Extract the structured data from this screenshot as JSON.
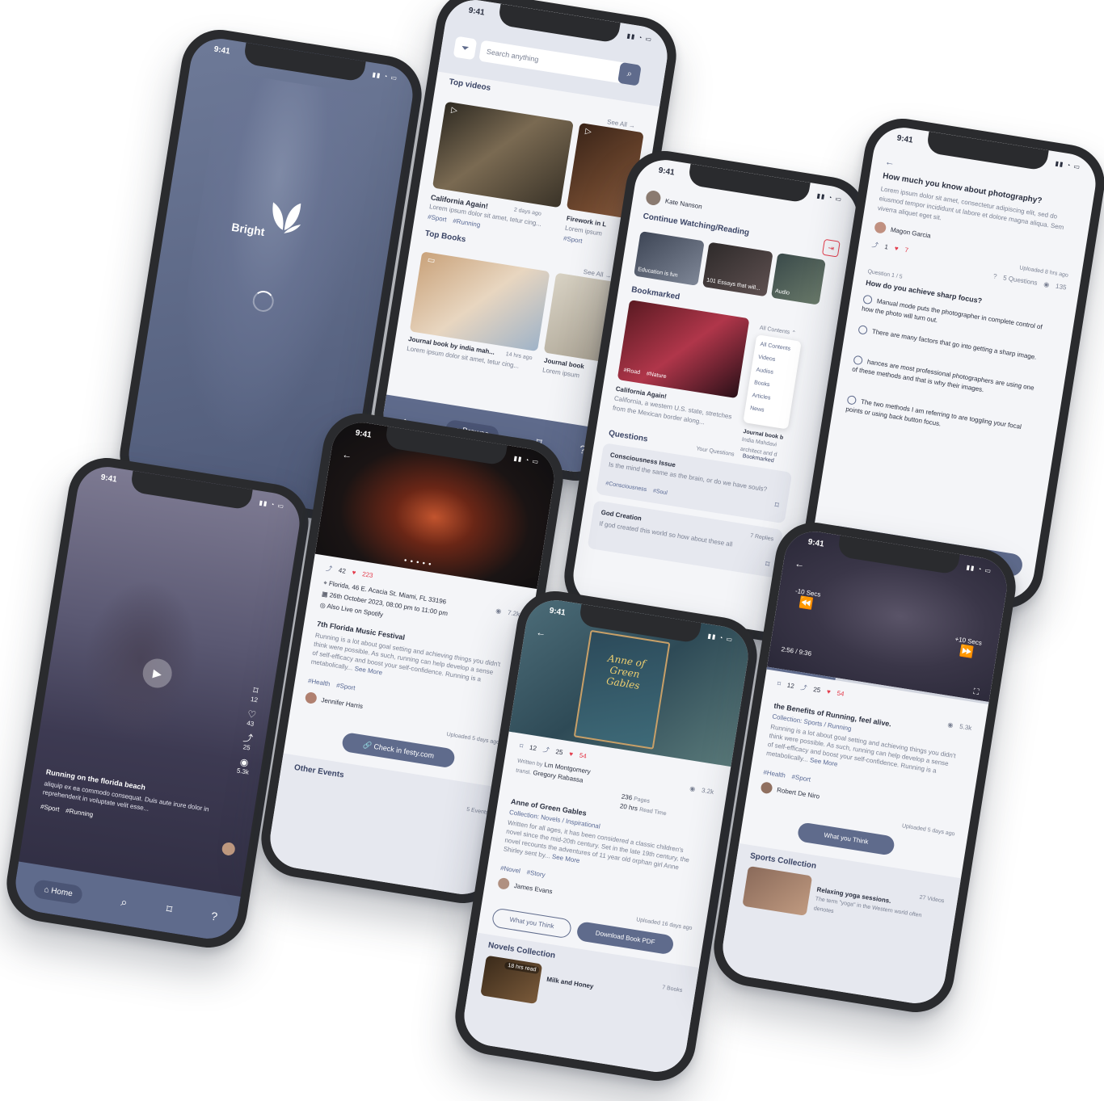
{
  "status_time": "9:41",
  "splash": {
    "brand": "Bright"
  },
  "browse": {
    "search_placeholder": "Search anything",
    "top_videos_title": "Top videos",
    "see_all": "See All →",
    "video1_title": "California Again!",
    "video1_desc": "Lorem ipsum dolor sit amet, tetur cing...",
    "video1_time": "2 days ago",
    "video1_tags": [
      "#Sport",
      "#Running"
    ],
    "video2_title": "Firework in L",
    "video2_desc": "Lorem ipsum",
    "video2_tags": [
      "#Sport"
    ],
    "top_books_title": "Top Books",
    "book1_title": "Journal book by india mah...",
    "book1_desc": "Lorem ipsum dolor sit amet, tetur cing...",
    "book1_time": "14 hrs ago",
    "book2_title": "Journal book",
    "book2_desc": "Lorem ipsum",
    "nav_browse": "Browse"
  },
  "home": {
    "user_name": "Kate Nanson",
    "continue_title": "Continue Watching/Reading",
    "cw1": "Education is fun",
    "cw2": "101 Essays that will...",
    "cw3": "Audio",
    "bookmarked_title": "Bookmarked",
    "filter_label": "All Contents",
    "filter_options": [
      "All Contents",
      "Videos",
      "Audios",
      "Books",
      "Articles",
      "News"
    ],
    "bm_tags": [
      "#Road",
      "#Nature"
    ],
    "bm_title": "California Again!",
    "bm_desc": "California, a western U.S. state, stretches from the Mexican border along...",
    "bm2_title": "Journal book b",
    "bm2_desc": "India Mahdavi architect and d",
    "questions_title": "Questions",
    "q_tab1": "Your Questions",
    "q_tab2": "Bookmarked",
    "q1_title": "Consciousness Issue",
    "q1_desc": "Is the mind the same as the brain, or do we have souls?",
    "q1_tags": [
      "#Consciousness",
      "#Soul"
    ],
    "q2_title": "God Creation",
    "q2_replies": "7 Replies",
    "q2_desc": "If god created this world so how about these all"
  },
  "quiz": {
    "title": "How much you know about photography?",
    "desc": "Lorem ipsum dolor sit amet, consectetur adipiscing elit, sed do eiusmod tempor incididunt ut labore et dolore magna aliqua. Sem viverra aliquet eget sit.",
    "author": "Magon Garcia",
    "uploaded": "Uploaded 8 hrs ago",
    "shares": "1",
    "likes": "7",
    "questions_count": "5 Questions",
    "views": "135",
    "question_label": "Question 1 / 5",
    "question": "How do you achieve sharp focus?",
    "options": [
      "Manual mode puts the photographer in complete control of how the photo will turn out.",
      "There are many factors that go into getting a sharp image.",
      "hances are most professional photographers are using one of these methods and that is why their images.",
      "The two methods I am referring to are toggling your focal points or using back button focus."
    ],
    "next": "Next"
  },
  "reels": {
    "bookmarks": "12",
    "likes": "43",
    "shares": "25",
    "views": "5.3k",
    "title": "Running on the florida beach",
    "desc": "aliquip ex ea commodo consequat. Duis aute irure dolor in reprehenderit in voluptate velit esse...",
    "tags": [
      "#Sport",
      "#Running"
    ],
    "nav_home": "Home"
  },
  "event": {
    "shares": "42",
    "likes": "223",
    "views": "7.2k",
    "address": "Florida, 46 E. Acacia St. Miami, FL 33196",
    "date": "26th October 2023, 08:00 pm to 11:00 pm",
    "live": "Also Live on Spotify",
    "title": "7th Florida Music Festival",
    "desc": "Running is a lot about goal setting and achieving things you didn't think were possible. As such, running can help develop a sense of self-efficacy and boost your self-confidence. Running is a metabolically...",
    "see_more": "See More",
    "tags": [
      "#Health",
      "#Sport"
    ],
    "author": "Jennifer Harris",
    "uploaded": "Uploaded 5 days ago",
    "cta": "Check in festy.com",
    "other_title": "Other Events",
    "other_count": "5 Events"
  },
  "book": {
    "bookmarks": "12",
    "shares": "25",
    "likes": "54",
    "views": "3.2k",
    "written_by_label": "Written by",
    "author": "Lm Montgomery",
    "translated_label": "transl.",
    "translator": "Gregory Rabassa",
    "pages": "236",
    "pages_label": "Pages",
    "read_time": "20 hrs",
    "read_time_label": "Read Time",
    "title": "Anne of Green Gables",
    "collection": "Collection: Novels / Inspirational",
    "desc": "Written for all ages, it has been considered a classic children's novel since the mid-20th century. Set in the late 19th century, the novel recounts the adventures of 11 year old orphan girl Anne Shirley sent by...",
    "see_more": "See More",
    "tags": [
      "#Novel",
      "#Story"
    ],
    "uploader": "James Evans",
    "uploaded": "Uploaded 16 days ago",
    "think": "What you Think",
    "download": "Download Book PDF",
    "novels_title": "Novels Collection",
    "novels_count": "7 Books",
    "novel1_badge": "18 hrs read",
    "novel1_title": "Milk and Honey",
    "cover_title": "Anne of Green Gables"
  },
  "player": {
    "rewind": "-10 Secs",
    "forward": "+10 Secs",
    "time": "2:56 / 9:36",
    "progress": 0.31,
    "bookmarks": "12",
    "shares": "25",
    "likes": "54",
    "views": "5.3k",
    "title": "the Benefits of Running, feel alive.",
    "collection": "Collection: Sports / Running",
    "desc": "Running is a lot about goal setting and achieving things you didn't think were possible. As such, running can help develop a sense of self-efficacy and boost your self-confidence. Running is a metabolically...",
    "see_more": "See More",
    "tags": [
      "#Health",
      "#Sport"
    ],
    "author": "Robert De Niro",
    "uploaded": "Uploaded 5 days ago",
    "think": "What you Think",
    "sports_title": "Sports Collection",
    "sports_count": "27 Videos",
    "sports1_title": "Relaxing yoga sessions.",
    "sports1_desc": "The term \"yoga\" in the Western world often denotes"
  },
  "colors": {
    "primary": "#5f6b8c",
    "accent": "#e33b4b",
    "background": "#f4f5f8",
    "frame": "#2a2b2e"
  }
}
